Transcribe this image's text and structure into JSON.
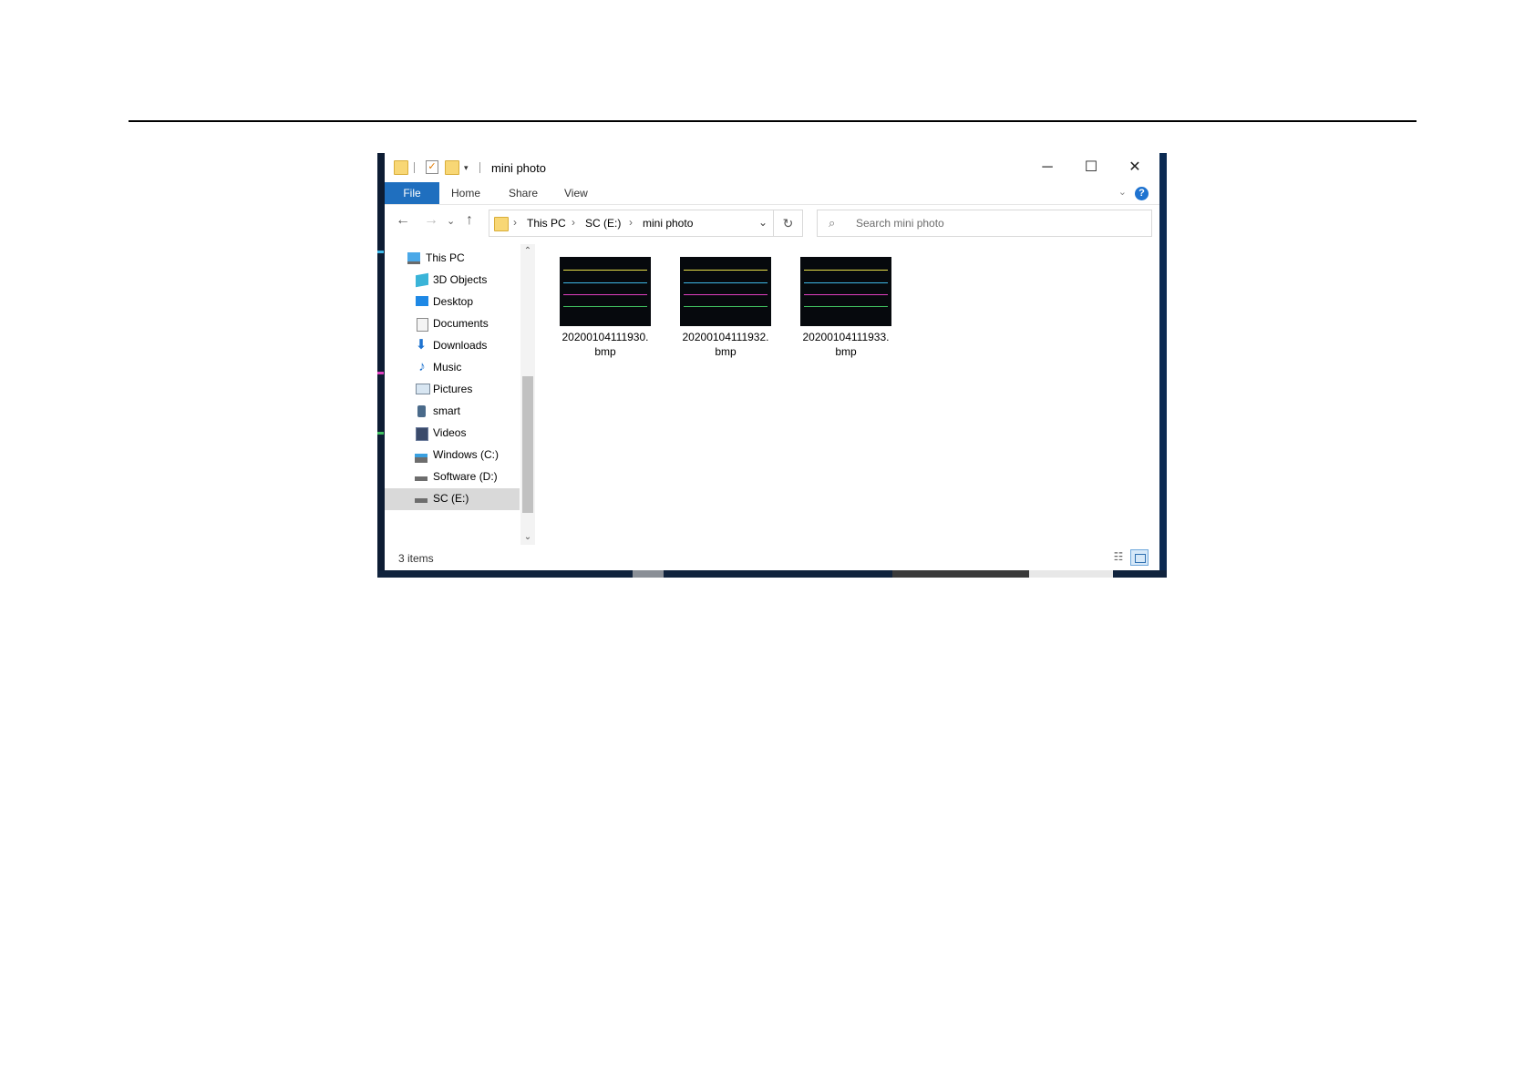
{
  "window": {
    "title": "mini photo",
    "controls": {
      "minimize": "─",
      "maximize": "☐",
      "close": "✕"
    }
  },
  "quick_access": {
    "dropdown": "▾"
  },
  "ribbon": {
    "tabs": [
      "File",
      "Home",
      "Share",
      "View"
    ],
    "collapse": "⌄",
    "help": "?"
  },
  "nav": {
    "back": "←",
    "forward": "→",
    "recent": "⌄",
    "up": "↑"
  },
  "address": {
    "crumbs": [
      "This PC",
      "SC (E:)",
      "mini photo"
    ],
    "separator": "›",
    "dropdown": "⌄",
    "refresh": "↻"
  },
  "search": {
    "placeholder": "Search mini photo",
    "icon": "⌕"
  },
  "navpane": {
    "items": [
      {
        "label": "This PC",
        "icon": "computer-icon"
      },
      {
        "label": "3D Objects",
        "icon": "cube-icon"
      },
      {
        "label": "Desktop",
        "icon": "desktop-icon"
      },
      {
        "label": "Documents",
        "icon": "document-icon"
      },
      {
        "label": "Downloads",
        "icon": "download-icon"
      },
      {
        "label": "Music",
        "icon": "music-icon"
      },
      {
        "label": "Pictures",
        "icon": "pictures-icon"
      },
      {
        "label": "smart",
        "icon": "phone-icon"
      },
      {
        "label": "Videos",
        "icon": "video-icon"
      },
      {
        "label": "Windows (C:)",
        "icon": "drive-icon"
      },
      {
        "label": "Software (D:)",
        "icon": "drive-icon"
      },
      {
        "label": "SC (E:)",
        "icon": "drive-icon",
        "selected": true
      }
    ],
    "scroll_up": "⌃",
    "scroll_down": "⌄"
  },
  "files": [
    {
      "name": "20200104111930.bmp",
      "line1": "20200104111930.",
      "line2": "bmp"
    },
    {
      "name": "20200104111932.bmp",
      "line1": "20200104111932.",
      "line2": "bmp"
    },
    {
      "name": "20200104111933.bmp",
      "line1": "20200104111933.",
      "line2": "bmp"
    }
  ],
  "status": {
    "text": "3 items",
    "details_icon": "☷"
  },
  "colors": {
    "accent": "#1f6fbf",
    "trace_yellow": "#e8e04a",
    "trace_cyan": "#3fb8e8",
    "trace_magenta": "#e040c0",
    "trace_green": "#40c060"
  }
}
